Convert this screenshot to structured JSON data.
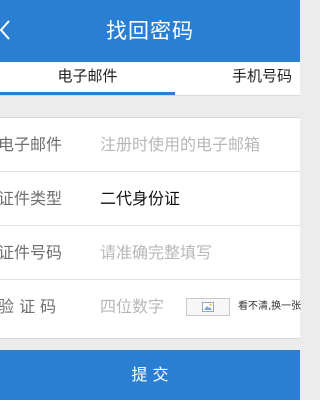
{
  "header": {
    "title": "找回密码"
  },
  "tabs": [
    {
      "label": "电子邮件"
    },
    {
      "label": "手机号码"
    }
  ],
  "form": {
    "email": {
      "label": "电子邮件",
      "placeholder": "注册时使用的电子邮箱"
    },
    "id_type": {
      "label": "证件类型",
      "value": "二代身份证"
    },
    "id_number": {
      "label": "证件号码",
      "placeholder": "请准确完整填写"
    },
    "captcha": {
      "label": "验 证 码",
      "placeholder": "四位数字",
      "refresh_text": "看不清,换一张"
    }
  },
  "submit": {
    "label": "提 交"
  },
  "colors": {
    "accent": "#2a7fd2",
    "background": "#ececec"
  }
}
